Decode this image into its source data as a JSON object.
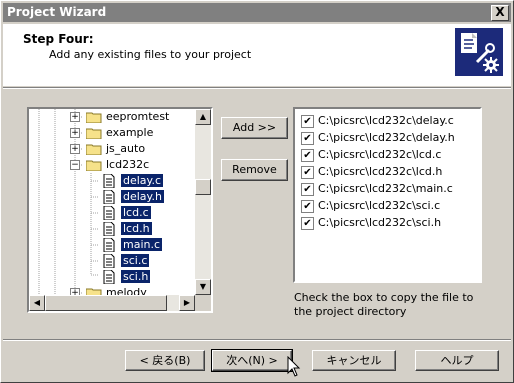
{
  "window": {
    "title": "Project Wizard",
    "close_glyph": "X"
  },
  "header": {
    "step_title": "Step Four:",
    "step_description": "Add any existing files to your project",
    "logo_icon": "wizard-tools-icon"
  },
  "tree": {
    "folders": [
      {
        "label": "eepromtest",
        "expander": "+"
      },
      {
        "label": "example",
        "expander": "+"
      },
      {
        "label": "js_auto",
        "expander": "+"
      },
      {
        "label": "lcd232c",
        "expander": "−"
      }
    ],
    "files": [
      "delay.c",
      "delay.h",
      "lcd.c",
      "lcd.h",
      "main.c",
      "sci.c",
      "sci.h"
    ],
    "last_folder": {
      "label": "melody",
      "expander": "+"
    }
  },
  "buttons": {
    "add": "Add >>",
    "remove": "Remove"
  },
  "file_list": {
    "items": [
      "C:\\picsrc\\lcd232c\\delay.c",
      "C:\\picsrc\\lcd232c\\delay.h",
      "C:\\picsrc\\lcd232c\\lcd.c",
      "C:\\picsrc\\lcd232c\\lcd.h",
      "C:\\picsrc\\lcd232c\\main.c",
      "C:\\picsrc\\lcd232c\\sci.c",
      "C:\\picsrc\\lcd232c\\sci.h"
    ],
    "check_glyph": "✔"
  },
  "note": "Check the box to copy the file to the project directory",
  "footer": {
    "back": "< 戻る(B)",
    "next": "次へ(N) >",
    "cancel": "キャンセル",
    "help": "ヘルプ"
  },
  "colors": {
    "selection": "#0a246a",
    "logo_bg": "#1c2a7a",
    "titlebar": "#808080"
  }
}
